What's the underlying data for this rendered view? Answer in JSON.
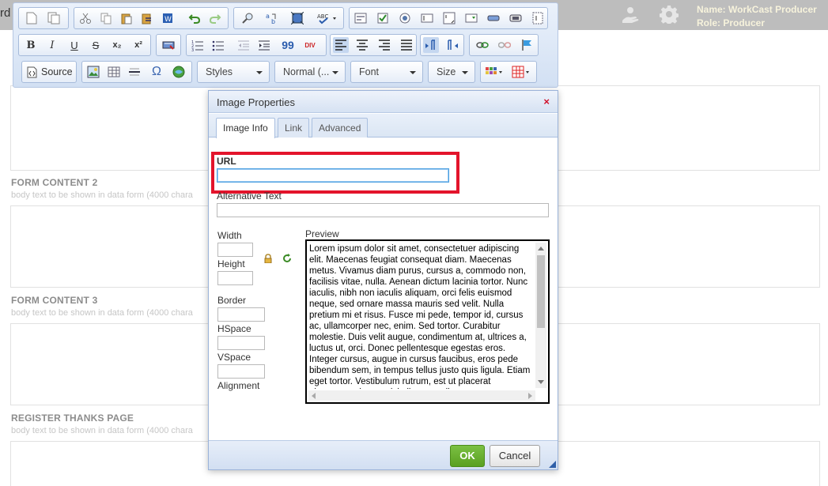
{
  "topbar": {
    "left_cut_text": "rd",
    "user_name": "Name: WorkCast Producer",
    "user_role": "Role: Producer",
    "icons": [
      "user-hand-icon",
      "gear-icon"
    ]
  },
  "page": {
    "sections": [
      {
        "title": "FORM CONTENT 2",
        "hint": "body text to be shown in data form (4000 chara"
      },
      {
        "title": "FORM CONTENT 3",
        "hint": "body text to be shown in data form (4000 chara"
      },
      {
        "title": "REGISTER THANKS PAGE",
        "hint": "body text to be shown in data form (4000 chara"
      }
    ]
  },
  "toolbar": {
    "source_label": "Source",
    "styles_label": "Styles",
    "format_label": "Normal (...",
    "font_label": "Font",
    "size_label": "Size",
    "row1_icons": [
      "new-page-icon",
      "templates-icon",
      "cut-icon",
      "copy-icon",
      "paste-icon",
      "paste-text-icon",
      "paste-word-icon",
      "undo-icon",
      "redo-icon",
      "find-icon",
      "replace-icon",
      "select-all-icon",
      "spellcheck-icon",
      "form-icon",
      "checkbox-icon",
      "radio-icon",
      "textfield-icon",
      "textarea-icon",
      "select-icon",
      "button-icon",
      "image-button-icon",
      "hidden-field-icon"
    ],
    "row2_icons": [
      "bold-icon",
      "italic-icon",
      "underline-icon",
      "strike-icon",
      "subscript-icon",
      "superscript-icon",
      "remove-format-icon",
      "numbered-list-icon",
      "bulleted-list-icon",
      "outdent-icon",
      "indent-icon",
      "blockquote-icon",
      "div-icon",
      "align-left-icon",
      "align-center-icon",
      "align-right-icon",
      "justify-icon",
      "ltr-icon",
      "rtl-icon",
      "link-icon",
      "unlink-icon",
      "anchor-icon"
    ],
    "row2_labels": {
      "bold": "B",
      "italic": "I",
      "underline": "U",
      "strike": "S",
      "subscript": "x₂",
      "superscript": "x²",
      "blockquote": "99",
      "div": "DIV"
    },
    "row3_icons": [
      "image-icon",
      "table-icon",
      "horizontal-rule-icon",
      "special-char-icon",
      "iframe-icon",
      "text-color-icon",
      "table-grid-icon"
    ],
    "row3_labels": {
      "special_char": "Ω"
    }
  },
  "dialog": {
    "title": "Image Properties",
    "close_glyph": "×",
    "tabs": [
      "Image Info",
      "Link",
      "Advanced"
    ],
    "url_label": "URL",
    "url_value": "",
    "alt_label": "Alternative Text",
    "alt_value": "",
    "width_label": "Width",
    "height_label": "Height",
    "border_label": "Border",
    "hspace_label": "HSpace",
    "vspace_label": "VSpace",
    "alignment_label": "Alignment",
    "preview_label": "Preview",
    "preview_text": "Lorem ipsum dolor sit amet, consectetuer adipiscing elit. Maecenas feugiat consequat diam. Maecenas metus. Vivamus diam purus, cursus a, commodo non, facilisis vitae, nulla. Aenean dictum lacinia tortor. Nunc iaculis, nibh non iaculis aliquam, orci felis euismod neque, sed ornare massa mauris sed velit. Nulla pretium mi et risus. Fusce mi pede, tempor id, cursus ac, ullamcorper nec, enim. Sed tortor. Curabitur molestie. Duis velit augue, condimentum at, ultrices a, luctus ut, orci. Donec pellentesque egestas eros. Integer cursus, augue in cursus faucibus, eros pede bibendum sem, in tempus tellus justo quis ligula. Etiam eget tortor. Vestibulum rutrum, est ut placerat elementum, lectus nisl aliquam velit.",
    "ok_label": "OK",
    "cancel_label": "Cancel"
  },
  "colors": {
    "topbar_bg": "#bdbdbd",
    "user_text": "#f7f3dc",
    "highlight": "#e3142b",
    "ok_green": "#5aa021",
    "close_red": "#d0102a"
  }
}
